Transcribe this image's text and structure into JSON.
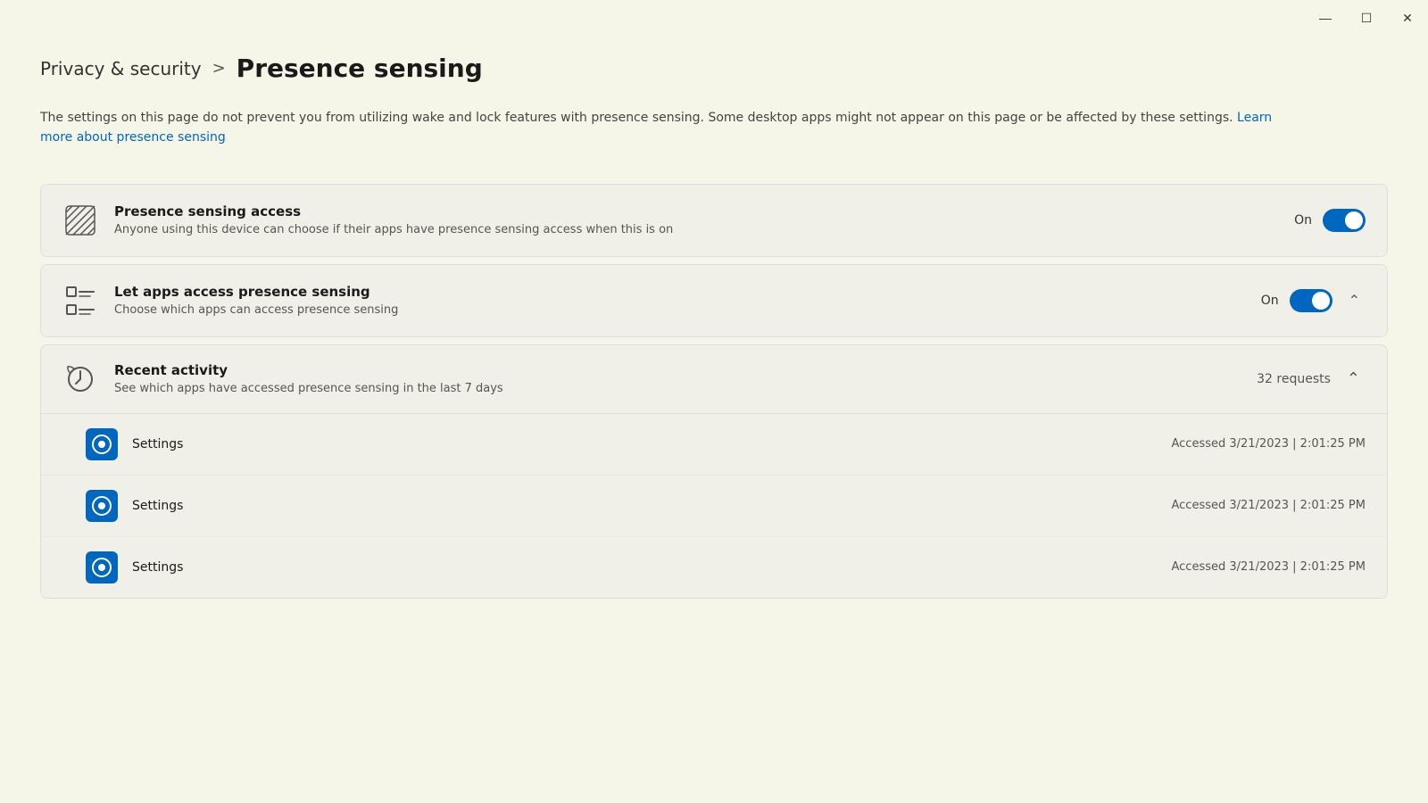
{
  "window": {
    "title": "Privacy & security - Presence sensing",
    "titlebar": {
      "minimize_label": "Minimize",
      "maximize_label": "Maximize",
      "close_label": "Close",
      "minimize_icon": "—",
      "maximize_icon": "☐",
      "close_icon": "✕"
    }
  },
  "breadcrumb": {
    "parent": "Privacy & security",
    "separator": ">",
    "current": "Presence sensing"
  },
  "description": {
    "text": "The settings on this page do not prevent you from utilizing wake and lock features with presence sensing. Some desktop apps might not appear on this page or be affected by these settings.",
    "link_text": "Learn more about presence sensing",
    "link_href": "#"
  },
  "settings": [
    {
      "id": "presence-sensing-access",
      "title": "Presence sensing access",
      "description": "Anyone using this device can choose if their apps have presence sensing access when this is on",
      "toggle_state": "On",
      "toggle_on": true,
      "has_chevron": false
    },
    {
      "id": "let-apps-access",
      "title": "Let apps access presence sensing",
      "description": "Choose which apps can access presence sensing",
      "toggle_state": "On",
      "toggle_on": true,
      "has_chevron": true
    }
  ],
  "recent_activity": {
    "title": "Recent activity",
    "description": "See which apps have accessed presence sensing in the last 7 days",
    "request_count": "32 requests",
    "is_expanded": true,
    "entries": [
      {
        "app_name": "Settings",
        "access_time": "Accessed 3/21/2023  |  2:01:25 PM"
      },
      {
        "app_name": "Settings",
        "access_time": "Accessed 3/21/2023  |  2:01:25 PM"
      },
      {
        "app_name": "Settings",
        "access_time": "Accessed 3/21/2023  |  2:01:25 PM"
      }
    ]
  }
}
